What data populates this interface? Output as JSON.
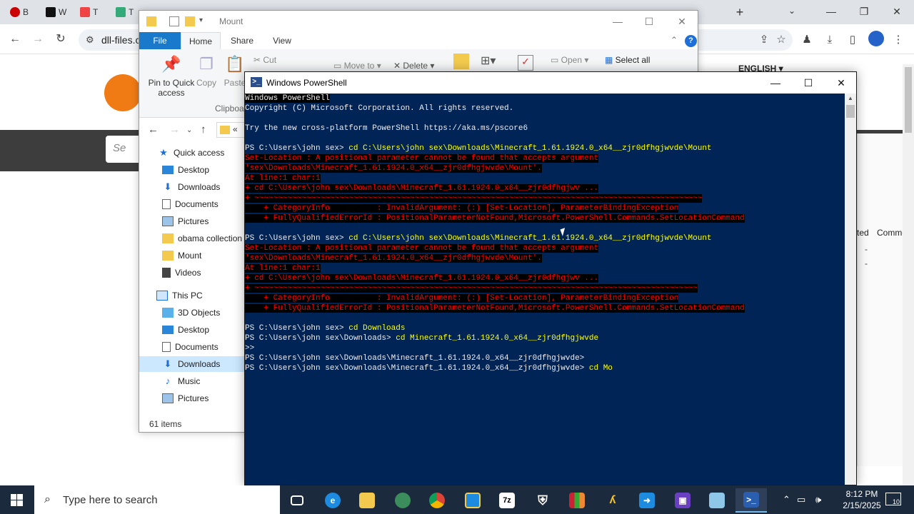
{
  "chrome": {
    "tabs": [
      "B",
      "W",
      "T",
      "T"
    ],
    "url": "dll-files.co",
    "new_tab_label": "+",
    "tab_search_label": "⌄",
    "win_minimize": "—",
    "win_restore": "❐",
    "win_close": "✕"
  },
  "site": {
    "search_placeholder": "Se",
    "language": "ENGLISH ▾",
    "col_updated": "ted",
    "col_comment": "Comment",
    "dash": "-"
  },
  "explorer": {
    "title": "Mount",
    "minimize": "—",
    "maximize": "☐",
    "close": "✕",
    "tabs": {
      "file": "File",
      "home": "Home",
      "share": "Share",
      "view": "View"
    },
    "ribbon": {
      "pin": "Pin to Quick access",
      "copy": "Copy",
      "paste": "Paste",
      "cut": "Cut",
      "move_to": "Move to",
      "delete": "Delete",
      "open": "Open",
      "select_all": "Select all",
      "clipboard": "Clipboa"
    },
    "address": "«",
    "nav_items": [
      {
        "label": "Quick access",
        "icon": "star-icon"
      },
      {
        "label": "Desktop",
        "icon": "desktop-icon"
      },
      {
        "label": "Downloads",
        "icon": "download-icon"
      },
      {
        "label": "Documents",
        "icon": "document-icon"
      },
      {
        "label": "Pictures",
        "icon": "pictures-icon"
      },
      {
        "label": "obama collection",
        "icon": "folder-icon"
      },
      {
        "label": "Mount",
        "icon": "folder-icon"
      },
      {
        "label": "Videos",
        "icon": "videos-icon"
      },
      {
        "label": "This PC",
        "icon": "computer-icon"
      },
      {
        "label": "3D Objects",
        "icon": "cube-icon"
      },
      {
        "label": "Desktop",
        "icon": "desktop-icon"
      },
      {
        "label": "Documents",
        "icon": "document-icon"
      },
      {
        "label": "Downloads",
        "icon": "download-icon"
      },
      {
        "label": "Music",
        "icon": "music-icon"
      },
      {
        "label": "Pictures",
        "icon": "pictures-icon"
      }
    ],
    "status": "61 items"
  },
  "powershell": {
    "title": "Windows PowerShell",
    "minimize": "—",
    "maximize": "☐",
    "close": "✕",
    "lines": [
      {
        "text": "Windows PowerShell",
        "color": "w",
        "hl": true
      },
      {
        "text": "Copyright (C) Microsoft Corporation. All rights reserved.",
        "color": "w",
        "hl": false
      },
      {
        "text": "",
        "color": "w",
        "hl": false
      },
      {
        "text": "Try the new cross-platform PowerShell https://aka.ms/pscore6",
        "color": "w",
        "hl": false
      },
      {
        "text": "",
        "color": "w",
        "hl": false
      },
      {
        "text": "PS C:\\Users\\john sex> ",
        "cmd": "cd C:\\Users\\john sex\\Downloads\\Minecraft_1.61.1924.0_x64__zjr0dfhgjwvde\\Mount",
        "color": "w",
        "hl": false
      },
      {
        "text": "Set-Location : A positional parameter cannot be found that accepts argument",
        "color": "r",
        "hl": true
      },
      {
        "text": "'sex\\Downloads\\Minecraft_1.61.1924.0_x64__zjr0dfhgjwvde\\Mount'.",
        "color": "r",
        "hl": true
      },
      {
        "text": "At line:1 char:1",
        "color": "r",
        "hl": true
      },
      {
        "text": "+ cd C:\\Users\\john sex\\Downloads\\Minecraft_1.61.1924.0_x64__zjr0dfhgjwv ...",
        "color": "r",
        "hl": true
      },
      {
        "text": "+ ~~~~~~~~~~~~~~~~~~~~~~~~~~~~~~~~~~~~~~~~~~~~~~~~~~~~~~~~~~~~~~~~~~~~~~~~~~~~~~~~~~~~~~~~~~~~~~~",
        "color": "r",
        "hl": true
      },
      {
        "text": "    + CategoryInfo          : InvalidArgument: (:) [Set-Location], ParameterBindingException",
        "color": "r",
        "hl": true
      },
      {
        "text": "    + FullyQualifiedErrorId : PositionalParameterNotFound,Microsoft.PowerShell.Commands.SetLocationCommand",
        "color": "r",
        "hl": true
      },
      {
        "text": "",
        "color": "w",
        "hl": false
      },
      {
        "text": "PS C:\\Users\\john sex> ",
        "cmd": "cd C:\\Users\\john sex\\Downloads\\Minecraft_1.61.1924.0_x64__zjr0dfhgjwvde\\Mount",
        "color": "w",
        "hl": false
      },
      {
        "text": "Set-Location : A positional parameter cannot be found that accepts argument",
        "color": "r",
        "hl": true
      },
      {
        "text": "'sex\\Downloads\\Minecraft_1.61.1924.0_x64__zjr0dfhgjwvde\\Mount'.",
        "color": "r",
        "hl": true
      },
      {
        "text": "At line:1 char:1",
        "color": "r",
        "hl": true
      },
      {
        "text": "+ cd C:\\Users\\john sex\\Downloads\\Minecraft_1.61.1924.0_x64__zjr0dfhgjwv ...",
        "color": "r",
        "hl": true
      },
      {
        "text": "+ ~~~~~~~~~~~~~~~~~~~~~~~~~~~~~~~~~~~~~~~~~~~~~~~~~~~~~~~~~~~~~~~~~~~~~~~~~~~~~~~~~~~~~~~~~~~~~~",
        "color": "r",
        "hl": true
      },
      {
        "text": "    + CategoryInfo          : InvalidArgument: (:) [Set-Location], ParameterBindingException",
        "color": "r",
        "hl": true
      },
      {
        "text": "    + FullyQualifiedErrorId : PositionalParameterNotFound,Microsoft.PowerShell.Commands.SetLocationCommand",
        "color": "r",
        "hl": true
      },
      {
        "text": "",
        "color": "w",
        "hl": false
      },
      {
        "text": "PS C:\\Users\\john sex> ",
        "cmd": "cd Downloads",
        "color": "w",
        "hl": false
      },
      {
        "text": "PS C:\\Users\\john sex\\Downloads> ",
        "cmd": "cd Minecraft_1.61.1924.0_x64__zjr0dfhgjwvde",
        "color": "w",
        "hl": false
      },
      {
        "text": ">>",
        "color": "w",
        "hl": false
      },
      {
        "text": "PS C:\\Users\\john sex\\Downloads\\Minecraft_1.61.1924.0_x64__zjr0dfhgjwvde>",
        "color": "w",
        "hl": false
      },
      {
        "text": "PS C:\\Users\\john sex\\Downloads\\Minecraft_1.61.1924.0_x64__zjr0dfhgjwvde> ",
        "cmd": "cd Mo",
        "color": "w",
        "hl": false
      }
    ]
  },
  "taskbar": {
    "search_placeholder": "Type here to search",
    "time": "8:12 PM",
    "date": "2/15/2025",
    "notifications": "10",
    "apps": [
      "task-view",
      "edge",
      "file-explorer",
      "chrome-beta",
      "chrome",
      "snipping",
      "7zip",
      "security",
      "winrar",
      "inkscape",
      "store-app",
      "cpu-app",
      "paint",
      "powershell"
    ]
  },
  "colors": {
    "ps_background": "#012456",
    "ps_error": "#ff0000",
    "ps_command": "#ffff00",
    "explorer_file_tab": "#1979ca",
    "taskbar": "#1c2a3d"
  }
}
